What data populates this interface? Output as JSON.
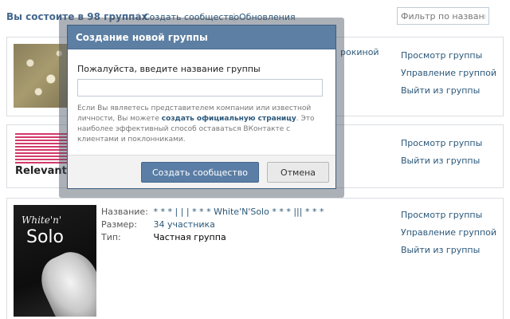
{
  "topbar": {
    "summary": "Вы состоите в 98 группах",
    "separator": "|",
    "create_link": "Создать сообщество",
    "updates_link": "Обновления",
    "filter_placeholder": "Фильтр по названию"
  },
  "groups": [
    {
      "partial_text": "рокиной",
      "actions": [
        "Просмотр группы",
        "Управление группой",
        "Выйти из группы"
      ]
    },
    {
      "logo_text": "Relevant",
      "actions": [
        "Просмотр группы",
        "Выйти из группы"
      ]
    },
    {
      "thumb_small": "White'n'",
      "thumb_big": "Solo",
      "info": {
        "name_label": "Название:",
        "name_value": "* * * | | | * * * White'N'Solo * * * ||| * * *",
        "size_label": "Размер:",
        "size_value": "34 участника",
        "type_label": "Тип:",
        "type_value": "Частная группа"
      },
      "actions": [
        "Просмотр группы",
        "Управление группой",
        "Выйти из группы"
      ]
    }
  ],
  "modal": {
    "title": "Создание новой группы",
    "label": "Пожалуйста, введите название группы",
    "input_value": "",
    "note_prefix": "Если Вы являетесь представителем компании или известной личности, Вы можете ",
    "note_link": "создать официальную страницу",
    "note_suffix": ". Это наиболее эффективный способ оставаться ВКонтакте с клиентами и поклонниками.",
    "create_button": "Создать сообщество",
    "cancel_button": "Отмена"
  },
  "colors": {
    "link": "#2b587a",
    "header": "#5c7fa3",
    "primary_button": "#5b7ea6"
  }
}
